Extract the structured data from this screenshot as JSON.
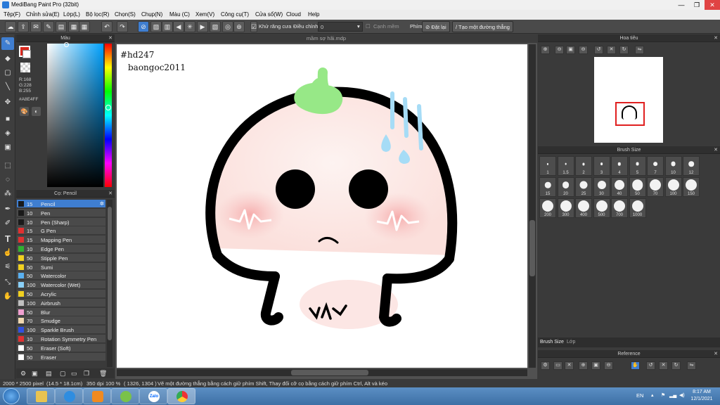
{
  "window": {
    "title": "MediBang Paint Pro (32bit)",
    "min": "—",
    "max": "❐",
    "close": "✕"
  },
  "menu": [
    "Tệp(F)",
    "Chỉnh sửa(E)",
    "Lớp(L)",
    "Bộ lọc(R)",
    "Chọn(S)",
    "Chụp(N)",
    "Màu (C)",
    "Xem(V)",
    "Công cụ(T)",
    "Cửa sổ(W)",
    "Cloud",
    "Help"
  ],
  "toolbar": {
    "antialias_label": "Khử răng cưa",
    "adjust_label": "Điều chỉnh",
    "adjust_value": "0",
    "sharp_label": "Cạnh mềm",
    "key_label": "Phím",
    "reset_label": "Đặt lại",
    "ruler_label": "Tạo một đường thẳng"
  },
  "color_panel": {
    "title": "Màu",
    "r": "R:168",
    "g": "G:228",
    "b": "B:255",
    "hex": "#A8E4FF",
    "primary": "#d9281e",
    "secondary": "#ffffff"
  },
  "brush_panel": {
    "title": "Cọ: Pencil",
    "brushes": [
      {
        "size": "15",
        "name": "Pencil",
        "color": "#1a1a1a",
        "selected": true
      },
      {
        "size": "10",
        "name": "Pen",
        "color": "#1a1a1a"
      },
      {
        "size": "10",
        "name": "Pen (Sharp)",
        "color": "#1a1a1a"
      },
      {
        "size": "15",
        "name": "G Pen",
        "color": "#e03030"
      },
      {
        "size": "15",
        "name": "Mapping Pen",
        "color": "#e03030"
      },
      {
        "size": "10",
        "name": "Edge Pen",
        "color": "#30b030"
      },
      {
        "size": "50",
        "name": "Stipple Pen",
        "color": "#f0d020"
      },
      {
        "size": "50",
        "name": "Sumi",
        "color": "#f0d020"
      },
      {
        "size": "50",
        "name": "Watercolor",
        "color": "#5ab0f0"
      },
      {
        "size": "100",
        "name": "Watercolor (Wet)",
        "color": "#8ad0f8"
      },
      {
        "size": "50",
        "name": "Acrylic",
        "color": "#f0d020"
      },
      {
        "size": "100",
        "name": "Airbrush",
        "color": "#c0c0c0"
      },
      {
        "size": "50",
        "name": "Blur",
        "color": "#f0a0d0"
      },
      {
        "size": "70",
        "name": "Smudge",
        "color": "#f0d8b0"
      },
      {
        "size": "100",
        "name": "Sparkle Brush",
        "color": "#3050e0"
      },
      {
        "size": "10",
        "name": "Rotation Symmetry Pen",
        "color": "#e03030"
      },
      {
        "size": "50",
        "name": "Eraser (Soft)",
        "color": "#ffffff"
      },
      {
        "size": "50",
        "name": "Eraser",
        "color": "#ffffff"
      }
    ]
  },
  "document": {
    "tab_title": "mầm sợ hãi.mdp",
    "text_line1": "#hd247",
    "text_line2": "baongoc2011"
  },
  "navigator": {
    "title": "Hoa tiêu"
  },
  "brush_size": {
    "title": "Brush Size",
    "sizes": [
      "1",
      "1.5",
      "2",
      "3",
      "4",
      "5",
      "7",
      "10",
      "12",
      "15",
      "20",
      "25",
      "30",
      "40",
      "50",
      "70",
      "100",
      "150",
      "200",
      "300",
      "400",
      "500",
      "700",
      "1000"
    ],
    "tabs": [
      "Brush Size",
      "Lớp"
    ]
  },
  "reference": {
    "title": "Reference"
  },
  "status": {
    "dimensions": "2000 * 2500 pixel",
    "physical": "(14.5 * 18.1cm)",
    "dpi": "350 dpi",
    "zoom": "100 %",
    "coords": "( 1326, 1304 )",
    "hint": "Vẽ một đường thẳng bằng cách giữ phím Shift, Thay đổi cỡ cọ bằng cách giữ phím Ctrl, Alt và kéo"
  },
  "taskbar": {
    "lang": "EN",
    "time": "8:17 AM",
    "date": "12/1/2021",
    "zalo": "Zalo"
  }
}
